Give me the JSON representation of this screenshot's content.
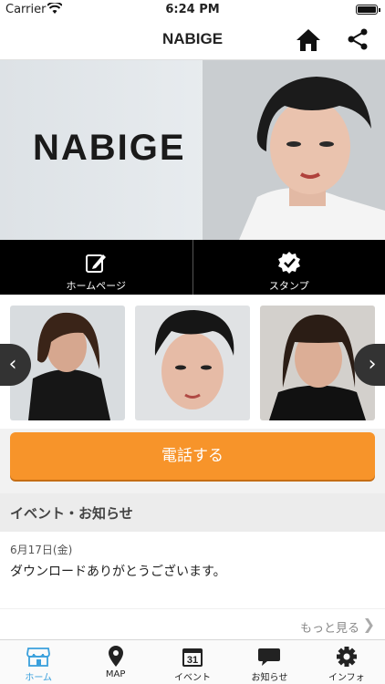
{
  "status": {
    "carrier": "Carrier",
    "time": "6:24 PM"
  },
  "nav": {
    "title": "NABIGE"
  },
  "hero": {
    "brand": "NABIGE"
  },
  "actions": [
    {
      "label": "ホームページ",
      "icon": "edit-page-icon"
    },
    {
      "label": "スタンプ",
      "icon": "stamp-check-icon"
    }
  ],
  "gallery": {
    "prev": "‹",
    "next": "›"
  },
  "call_button": "電話する",
  "events": {
    "heading": "イベント・お知らせ",
    "items": [
      {
        "date": "6月17日(金)",
        "text": "ダウンロードありがとうございます。"
      }
    ],
    "more": "もっと見る"
  },
  "tabs": [
    {
      "label": "ホーム",
      "icon": "store-icon",
      "active": true
    },
    {
      "label": "MAP",
      "icon": "map-pin-icon",
      "active": false
    },
    {
      "label": "イベント",
      "icon": "calendar-icon",
      "badge": "31",
      "active": false
    },
    {
      "label": "お知らせ",
      "icon": "speech-bubble-icon",
      "active": false
    },
    {
      "label": "インフォ",
      "icon": "gear-icon",
      "active": false
    }
  ],
  "colors": {
    "accent": "#f7942a",
    "tab_active": "#3aa0dc"
  }
}
